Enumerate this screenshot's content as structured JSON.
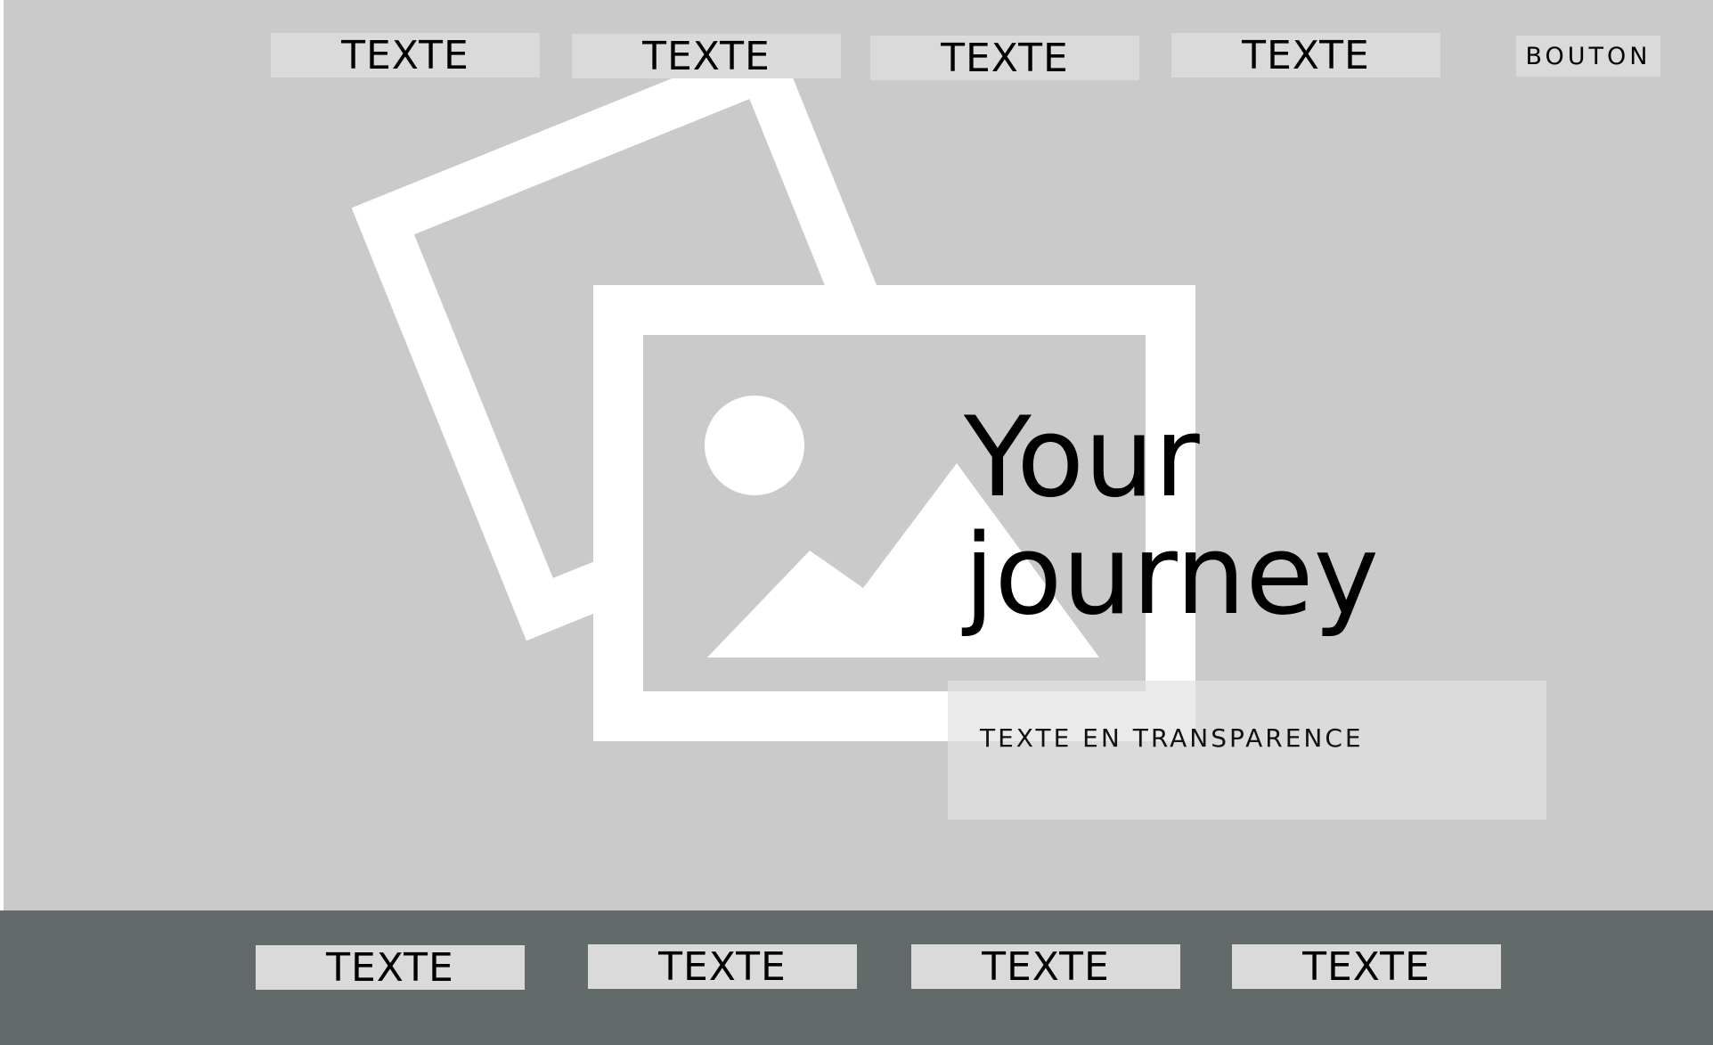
{
  "header": {
    "nav": [
      {
        "label": "TEXTE"
      },
      {
        "label": "TEXTE"
      },
      {
        "label": "TEXTE"
      },
      {
        "label": "TEXTE"
      }
    ],
    "button_label": "BOUTON"
  },
  "hero": {
    "title_line1": "Your",
    "title_line2": "journey",
    "transparent_text": "TEXTE EN TRANSPARENCE",
    "image_icon": "image-placeholder-icon"
  },
  "footer": {
    "nav": [
      {
        "label": "TEXTE"
      },
      {
        "label": "TEXTE"
      },
      {
        "label": "TEXTE"
      },
      {
        "label": "TEXTE"
      }
    ]
  },
  "colors": {
    "hero_background": "#cacaca",
    "block_fill": "#dadada",
    "footer_background": "#636b6a",
    "placeholder_white": "#ffffff"
  }
}
